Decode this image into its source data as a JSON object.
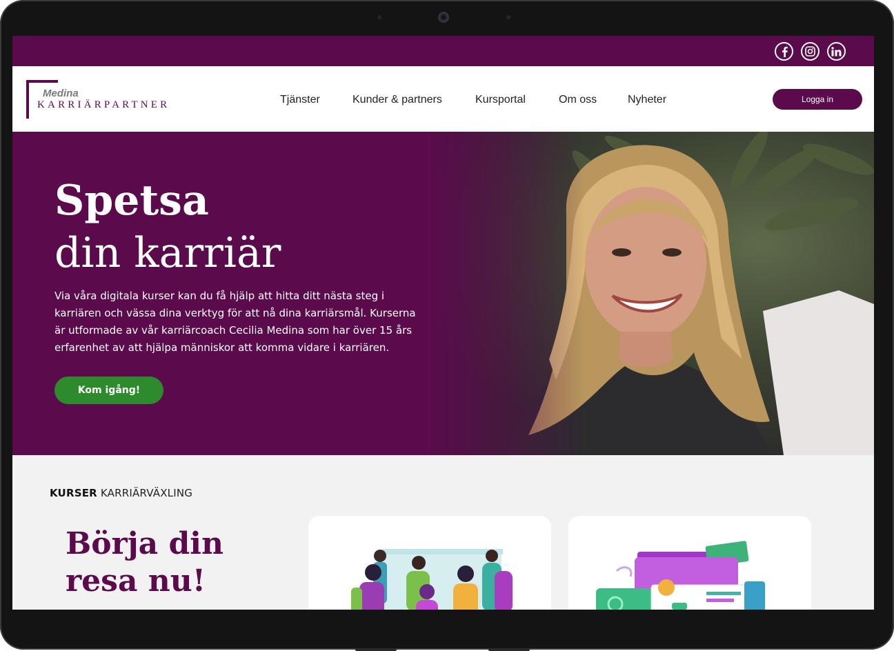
{
  "topbar": {
    "social": [
      {
        "icon": "facebook-icon",
        "label": "f"
      },
      {
        "icon": "instagram-icon",
        "label": ""
      },
      {
        "icon": "linkedin-icon",
        "label": "in"
      }
    ]
  },
  "brand": {
    "name_top": "Medina",
    "name_bottom": "KARRIÄRPARTNER",
    "color": "#5b0b4c"
  },
  "nav": {
    "items": [
      "Tjänster",
      "Kunder & partners",
      "Kursportal",
      "Om oss",
      "Nyheter"
    ],
    "login": "Logga in"
  },
  "hero": {
    "title_line1": "Spetsa",
    "title_line2": "din karriär",
    "text": "Via våra digitala kurser kan du få hjälp att hitta ditt nästa steg i karriären och vässa dina verktyg för att nå dina karriärsmål. Kurserna är utformade av vår karriärcoach Cecilia Medina som har över 15 års erfarenhet av att hjälpa människor att komma vidare i karriären.",
    "cta": "Kom igång!",
    "cta_color": "#2d8a2d"
  },
  "courses": {
    "kicker_bold": "KURSER",
    "kicker_rest": "KARRIÄRVÄXLING",
    "heading": "Börja din resa nu!"
  }
}
